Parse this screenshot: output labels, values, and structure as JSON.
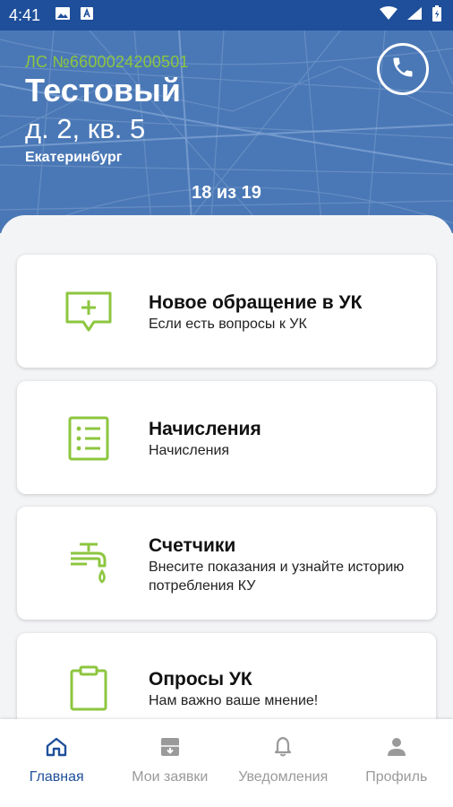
{
  "status_bar": {
    "time": "4:41"
  },
  "header": {
    "account": "ЛС №6600024200501",
    "name": "Тестовый",
    "address": "д. 2, кв. 5",
    "city": "Екатеринбург",
    "counter": "18 из 19"
  },
  "cards": [
    {
      "title": "Новое обращение в УК",
      "subtitle": "Если есть вопросы к УК",
      "icon": "message-plus-icon"
    },
    {
      "title": "Начисления",
      "subtitle": "Начисления",
      "icon": "list-icon"
    },
    {
      "title": "Счетчики",
      "subtitle": "Внесите показания и узнайте историю потребления КУ",
      "icon": "faucet-icon"
    },
    {
      "title": "Опросы УК",
      "subtitle": "Нам важно ваше мнение!",
      "icon": "clipboard-icon"
    }
  ],
  "nav": [
    {
      "label": "Главная",
      "icon": "home-icon",
      "active": true
    },
    {
      "label": "Мои заявки",
      "icon": "archive-icon",
      "active": false
    },
    {
      "label": "Уведомления",
      "icon": "bell-icon",
      "active": false
    },
    {
      "label": "Профиль",
      "icon": "person-icon",
      "active": false
    }
  ],
  "colors": {
    "brand_blue": "#1f4f9a",
    "accent_green": "#8dc63f",
    "header_blue": "#4a78b6"
  }
}
